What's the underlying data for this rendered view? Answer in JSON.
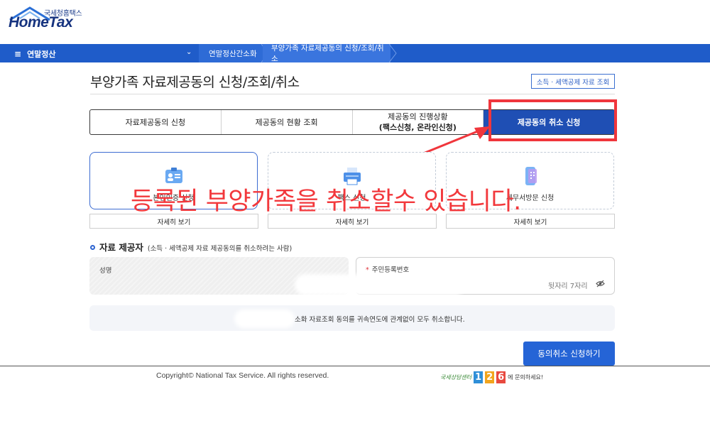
{
  "logo": {
    "sub": "국세청홈택스",
    "main": "HomeTax"
  },
  "nav": {
    "menu_label": "연말정산",
    "breadcrumb": [
      "연말정산간소화",
      "부양가족 자료제공동의 신청/조회/취소"
    ]
  },
  "page": {
    "title": "부양가족 자료제공동의 신청/조회/취소",
    "lookup_button": "소득 · 세액공제 자료 조회"
  },
  "tabs": [
    {
      "label": "자료제공동의 신청"
    },
    {
      "label": "제공동의 현황 조회"
    },
    {
      "label": "제공동의 진행상황",
      "sub": "(팩스신청, 온라인신청)"
    },
    {
      "label": "제공동의 취소 신청",
      "active": true
    }
  ],
  "cards": [
    {
      "label": "본인인증 신청",
      "icon": "id-card-icon"
    },
    {
      "label": "팩스 신청",
      "icon": "fax-icon"
    },
    {
      "label": "세무서방문 신청",
      "icon": "mobile-doc-icon"
    }
  ],
  "detail_button": "자세히 보기",
  "annotation": "등록된 부양가족을 취소할수 있습니다.",
  "provider_section": {
    "title": "자료 제공자",
    "desc": "(소득 · 세액공제 자료 제공동의를 취소하려는 사람)",
    "name_label": "성명",
    "id_required": "*",
    "id_label": "주민등록번호",
    "id_placeholder": "뒷자리 7자리"
  },
  "notice": "소화 자료조회 동의를 귀속연도에 관계없이 모두 취소합니다.",
  "submit_button": "동의취소 신청하기",
  "footer": {
    "copyright": "Copyright© National Tax Service. All rights reserved.",
    "call_prefix": "국세상담센터",
    "call_digits": [
      "1",
      "2",
      "6"
    ],
    "call_suffix": "에 문의하세요!"
  },
  "colors": {
    "brand": "#1f5cc9",
    "tab_active": "#1f4fb4",
    "highlight": "#f0363c",
    "button": "#2564d6"
  }
}
